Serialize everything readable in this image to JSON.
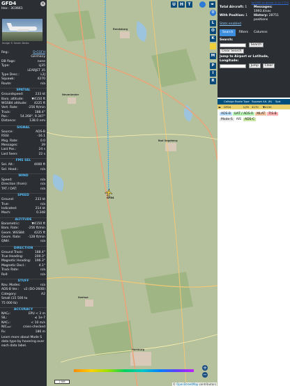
{
  "sidebar": {
    "callsign": "GFD4",
    "hex_label": "Hex :",
    "hex": "3C0661",
    "photo_credit": "Image © Seven Dezlo",
    "basic": [
      {
        "k": "Reg.:",
        "v": "D-CGFH",
        "link": true
      },
      {
        "k": "",
        "v": "Germany"
      },
      {
        "k": "DB flags:",
        "v": "none"
      },
      {
        "k": "Type:",
        "v": "LJ35"
      },
      {
        "k": "",
        "v": "LEARJET 35"
      },
      {
        "k": "Type Desc.:",
        "v": "L2J"
      },
      {
        "k": "Squawk:",
        "v": "4270"
      },
      {
        "k": "Route:",
        "v": "n/a"
      }
    ],
    "sections": [
      {
        "title": "SPATIAL",
        "rows": [
          {
            "k": "Groundspeed:",
            "v": "233 kt"
          },
          {
            "k": "Baro. altitude:",
            "v": "▼4150 ft"
          },
          {
            "k": "WGS84 altitude:",
            "v": "4225 ft"
          },
          {
            "k": "Vert. Rate:",
            "v": "-256 ft/min"
          },
          {
            "k": "Track:",
            "v": "188.4°"
          },
          {
            "k": "Pos.:",
            "v": "54.268°, 9.347°"
          },
          {
            "k": "Distance:",
            "v": "138.0 nmi"
          }
        ]
      },
      {
        "title": "SIGNAL",
        "rows": [
          {
            "k": "Source:",
            "v": "ADS-B"
          },
          {
            "k": "RSSI:",
            "v": "-16.1"
          },
          {
            "k": "Msg. Rate:",
            "v": "0.0"
          },
          {
            "k": "Messages:",
            "v": "39"
          },
          {
            "k": "Last Pos.:",
            "v": "24 s"
          },
          {
            "k": "Last Seen:",
            "v": "22 s"
          }
        ]
      },
      {
        "title": "FMS SEL",
        "rows": [
          {
            "k": "Sel. Alt.:",
            "v": "4000 ft"
          },
          {
            "k": "Sel. Head.:",
            "v": "n/a"
          }
        ]
      },
      {
        "title": "WIND",
        "rows": [
          {
            "k": "Speed:",
            "v": "n/a"
          },
          {
            "k": "Direction (from):",
            "v": "n/a"
          },
          {
            "k": "TAT / OAT:",
            "v": "n/a"
          }
        ]
      },
      {
        "title": "SPEED",
        "rows": [
          {
            "k": "Ground:",
            "v": "233 kt"
          },
          {
            "k": "True:",
            "v": "n/a"
          },
          {
            "k": "Indicated:",
            "v": "214 kt"
          },
          {
            "k": "Mach:",
            "v": "0.348"
          }
        ]
      },
      {
        "title": "ALTITUDE",
        "rows": [
          {
            "k": "Barometric:",
            "v": "▼4150 ft"
          },
          {
            "k": "Baro. Rate:",
            "v": "-256 ft/min"
          },
          {
            "k": "Geom. WGS84:",
            "v": "4225 ft"
          },
          {
            "k": "Geom. Rate:",
            "v": "-128 ft/min"
          },
          {
            "k": "QNH:",
            "v": "n/a"
          }
        ]
      },
      {
        "title": "DIRECTION",
        "rows": [
          {
            "k": "Ground Track:",
            "v": "188.4°"
          },
          {
            "k": "True Heading:",
            "v": "200.3°"
          },
          {
            "k": "Magnetic Heading:",
            "v": "196.3°"
          },
          {
            "k": "Magnetic Decl.:",
            "v": "4.1°"
          },
          {
            "k": "Track Rate:",
            "v": "n/a"
          },
          {
            "k": "Roll:",
            "v": "n/a"
          }
        ]
      },
      {
        "title": "STUFF",
        "rows": [
          {
            "k": "Nav. Modes:",
            "v": "n/a"
          },
          {
            "k": "ADS-B Ver.:",
            "v": "v2 (DO-260B)"
          },
          {
            "k": "Category:",
            "v": "A2"
          },
          {
            "k": "Small (15 500 to",
            "v": ""
          },
          {
            "k": "75 000 lb)",
            "v": ""
          }
        ]
      },
      {
        "title": "ACCURACY",
        "rows": [
          {
            "k": "NACₚ:",
            "v": "EPU < 3 m"
          },
          {
            "k": "SIL:",
            "v": "≤ 1e-7"
          },
          {
            "k": "NACᵥ:",
            "v": "< 10 m/s"
          },
          {
            "k": "NICₐₐ₀:",
            "v": "cross-checked"
          },
          {
            "k": "R₀:",
            "v": "186 m"
          }
        ]
      }
    ],
    "more_info": "Learn more about Mode S data type by hovering over each data label."
  },
  "map": {
    "top_buttons": [
      "U",
      "H",
      "T"
    ],
    "zoom_in": "+",
    "zoom_out": "−",
    "scale_label": "2 NM",
    "attribution_prefix": "© ",
    "attribution_link": "OpenStreetMap",
    "attribution_suffix": " contributors",
    "aircraft_label": "GFD4",
    "places": [
      "Rendsburg",
      "Neumünster",
      "Bad Segeberg",
      "Hamburg",
      "Itzehoe"
    ]
  },
  "strip": {
    "buttons": [
      "L",
      "O",
      "K",
      "M",
      "P",
      "I",
      "R"
    ]
  },
  "panel": {
    "version": "tar1090 on github (3 14 1773)",
    "stats": {
      "total_aircraft_label": "Total Aircraft:",
      "total_aircraft": "1",
      "with_position_label": "With Position:",
      "with_position": "1",
      "messages_label": "Messages:",
      "messages": "1993.4/sec",
      "history_label": "History:",
      "history": "28751 positions",
      "about": "Stats enabled"
    },
    "tabs": [
      "Search",
      "Filters",
      "Columns"
    ],
    "search_label": "Search:",
    "search_button": "Search",
    "clear_search_button": "Clear Search",
    "jump_label": "Jump to Airport or Latitude, Longitude:",
    "jump_button": "Jump",
    "clear_button": "Clear",
    "table": {
      "columns": [
        "Callsign",
        "Route",
        "Type",
        "Squawk",
        "Alt. (ft)",
        "Spd."
      ],
      "rows": [
        [
          "GFD4",
          "",
          "LJ35",
          "4270",
          "▼4150",
          ""
        ]
      ]
    },
    "legend": [
      "ADS-B",
      "UAT / ADS-R",
      "MLAT",
      "TIS-B",
      "Mode-S",
      "AIS",
      "ADS-C"
    ]
  }
}
